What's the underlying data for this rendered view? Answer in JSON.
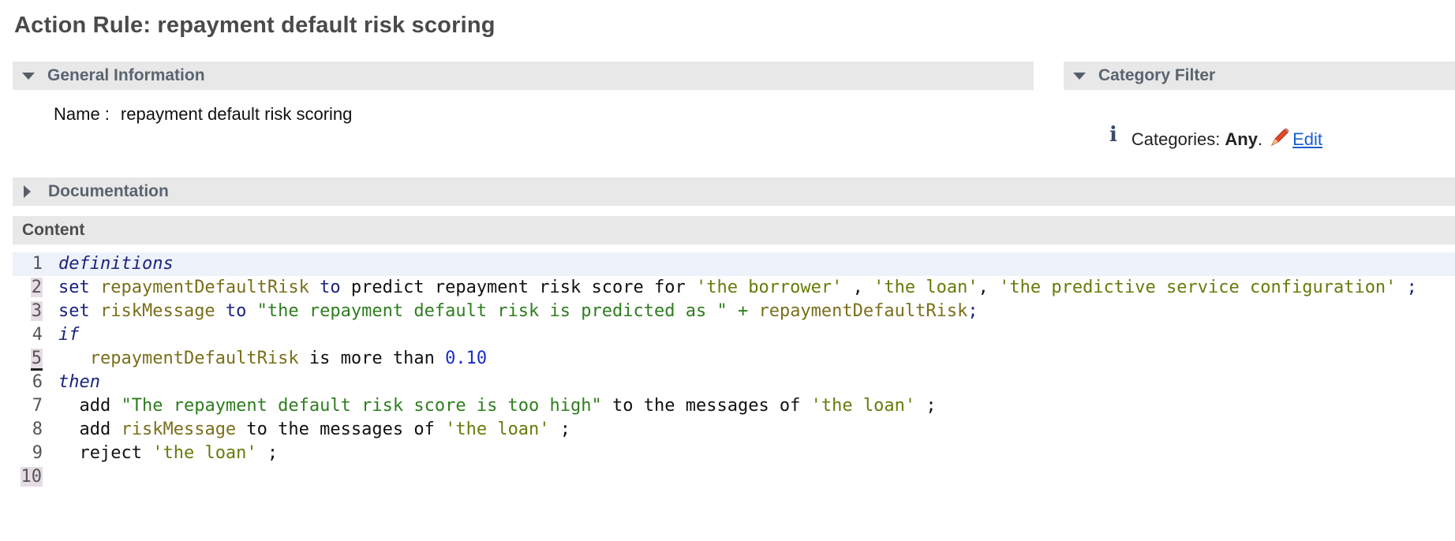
{
  "page": {
    "title": "Action Rule: repayment default risk scoring"
  },
  "general": {
    "header": "General Information",
    "name_label": "Name :",
    "name_value": "repayment default risk scoring"
  },
  "category": {
    "header": "Category Filter",
    "label": "Categories:",
    "value": "Any",
    "edit_label": "Edit"
  },
  "documentation": {
    "header": "Documentation"
  },
  "content": {
    "header": "Content",
    "lines": [
      {
        "n": "1",
        "tokens": [
          {
            "t": "definitions",
            "c": "kw-italic"
          }
        ]
      },
      {
        "n": "2",
        "tokens": [
          {
            "t": "set ",
            "c": "kw"
          },
          {
            "t": "repaymentDefaultRisk",
            "c": "var"
          },
          {
            "t": " to ",
            "c": "kw"
          },
          {
            "t": "predict repayment risk score for ",
            "c": "plain"
          },
          {
            "t": "'the borrower'",
            "c": "str"
          },
          {
            "t": " , ",
            "c": "plain"
          },
          {
            "t": "'the loan'",
            "c": "str"
          },
          {
            "t": ", ",
            "c": "plain"
          },
          {
            "t": "'the predictive service configuration'",
            "c": "str"
          },
          {
            "t": " ;",
            "c": "kw"
          }
        ]
      },
      {
        "n": "3",
        "tokens": [
          {
            "t": "set ",
            "c": "kw"
          },
          {
            "t": "riskMessage",
            "c": "var"
          },
          {
            "t": " to ",
            "c": "kw"
          },
          {
            "t": "\"the repayment default risk is predicted as \"",
            "c": "dstr"
          },
          {
            "t": " + ",
            "c": "dstr"
          },
          {
            "t": "repaymentDefaultRisk",
            "c": "var"
          },
          {
            "t": ";",
            "c": "kw"
          }
        ]
      },
      {
        "n": "4",
        "tokens": [
          {
            "t": "if",
            "c": "kw-italic"
          }
        ]
      },
      {
        "n": "5",
        "tokens": [
          {
            "t": "   ",
            "c": "plain"
          },
          {
            "t": "repaymentDefaultRisk",
            "c": "var"
          },
          {
            "t": " is more than ",
            "c": "plain"
          },
          {
            "t": "0.10",
            "c": "num"
          }
        ]
      },
      {
        "n": "6",
        "tokens": [
          {
            "t": "then",
            "c": "kw-italic"
          }
        ]
      },
      {
        "n": "7",
        "tokens": [
          {
            "t": "  add ",
            "c": "plain"
          },
          {
            "t": "\"The repayment default risk score is too high\"",
            "c": "dstr"
          },
          {
            "t": " to the messages of ",
            "c": "plain"
          },
          {
            "t": "'the loan'",
            "c": "str"
          },
          {
            "t": " ;",
            "c": "plain"
          }
        ]
      },
      {
        "n": "8",
        "tokens": [
          {
            "t": "  add ",
            "c": "plain"
          },
          {
            "t": "riskMessage",
            "c": "var"
          },
          {
            "t": " to the messages of ",
            "c": "plain"
          },
          {
            "t": "'the loan'",
            "c": "str"
          },
          {
            "t": " ;",
            "c": "plain"
          }
        ]
      },
      {
        "n": "9",
        "tokens": [
          {
            "t": "  reject ",
            "c": "plain"
          },
          {
            "t": "'the loan'",
            "c": "str"
          },
          {
            "t": " ;",
            "c": "plain"
          }
        ]
      },
      {
        "n": "10",
        "tokens": []
      }
    ]
  }
}
